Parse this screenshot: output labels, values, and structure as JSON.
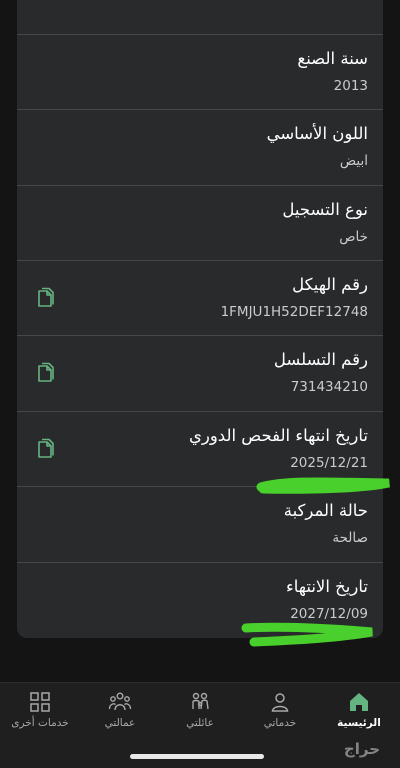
{
  "vehicle_details": [
    {
      "label": "سنة الصنع",
      "value": "2013",
      "copyable": false
    },
    {
      "label": "اللون الأساسي",
      "value": "ابيض",
      "copyable": false
    },
    {
      "label": "نوع التسجيل",
      "value": "خاص",
      "copyable": false
    },
    {
      "label": "رقم الهيكل",
      "value": "1FMJU1H52DEF12748",
      "copyable": true
    },
    {
      "label": "رقم التسلسل",
      "value": "731434210",
      "copyable": true
    },
    {
      "label": "تاريخ انتهاء الفحص الدوري",
      "value": "2025/12/21",
      "copyable": true
    },
    {
      "label": "حالة المركبة",
      "value": "صالحة",
      "copyable": false
    },
    {
      "label": "تاريخ الانتهاء",
      "value": "2027/12/09",
      "copyable": false
    }
  ],
  "bottom_nav": {
    "home": "الرئيسية",
    "my_services": "خدماتي",
    "my_family": "عائلتي",
    "my_workers": "عمالتي",
    "other_services": "خدمات أخرى"
  },
  "watermark": "حراج",
  "colors": {
    "accent": "#66b382",
    "highlight_marker": "#4cd92c",
    "card": "#282a2b",
    "background": "#141414"
  }
}
